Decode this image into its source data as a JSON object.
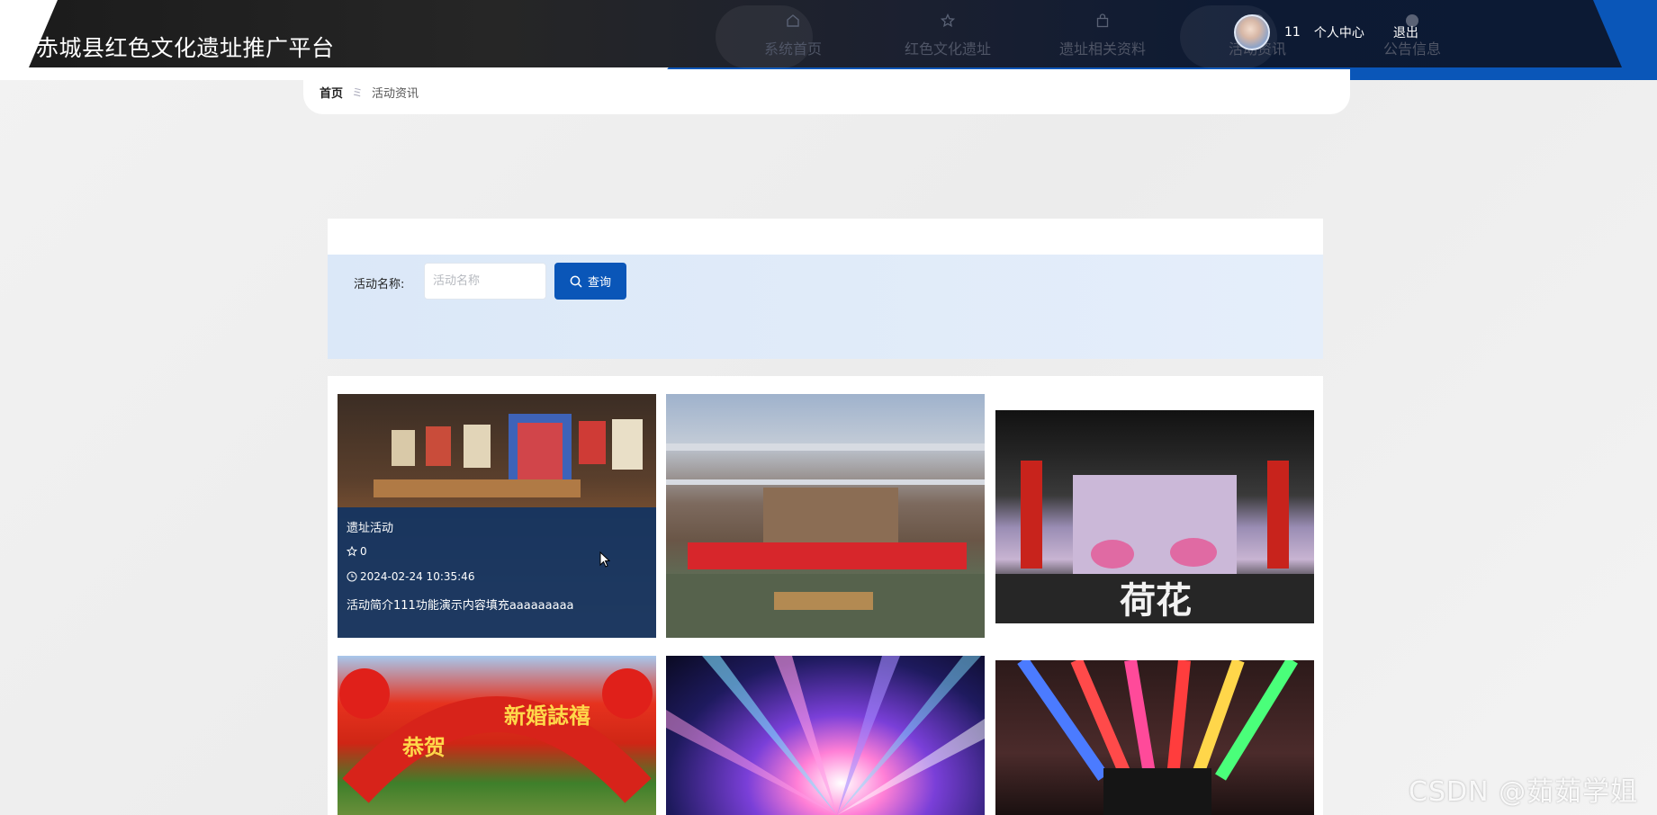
{
  "header": {
    "site_title": "赤城县红色文化遗址推广平台",
    "nav": [
      {
        "label": "系统首页",
        "icon": "home-icon"
      },
      {
        "label": "红色文化遗址",
        "icon": "star-icon"
      },
      {
        "label": "遗址相关资料",
        "icon": "bag-icon"
      },
      {
        "label": "活动资讯",
        "icon": "info-icon"
      },
      {
        "label": "公告信息",
        "icon": "bell-icon"
      }
    ],
    "user": {
      "name": "11",
      "center_label": "个人中心",
      "logout_label": "退出"
    }
  },
  "breadcrumb": {
    "home": "首页",
    "separator": "ミ",
    "current": "活动资讯"
  },
  "search": {
    "label": "活动名称:",
    "placeholder": "活动名称",
    "button_label": "查询"
  },
  "cards": [
    {
      "title": "遗址活动",
      "likes": "0",
      "time": "2024-02-24 10:35:46",
      "desc": "活动简介111功能演示内容填充aaaaaaaaa",
      "picture": "exhibition-hall-photo"
    },
    {
      "picture": "outdoor-stage-photo"
    },
    {
      "picture": "lotus-stage-photo"
    },
    {
      "picture": "red-arch-photo"
    },
    {
      "picture": "stage-light-photo"
    },
    {
      "picture": "rainbow-ceiling-photo"
    }
  ],
  "watermark": "CSDN @茹茹学姐",
  "colors": {
    "primary": "#0a56b8",
    "card_overlay": "#123462",
    "search_panel": "#dbe8f8"
  }
}
